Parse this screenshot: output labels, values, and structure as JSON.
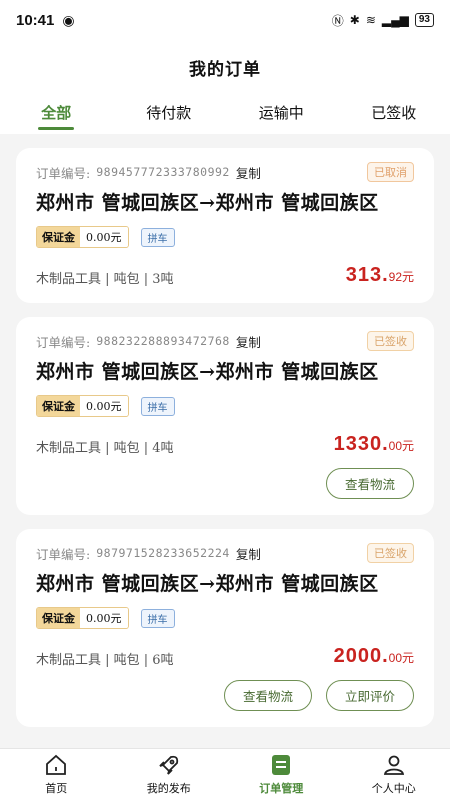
{
  "status_bar": {
    "time": "10:41",
    "battery": "93"
  },
  "header": {
    "title": "我的订单"
  },
  "tabs": [
    {
      "label": "全部",
      "active": true
    },
    {
      "label": "待付款",
      "active": false
    },
    {
      "label": "运输中",
      "active": false
    },
    {
      "label": "已签收",
      "active": false
    }
  ],
  "orders": [
    {
      "number_label": "订单编号:",
      "number": "989457772333780992",
      "copy_label": "复制",
      "status": "已取消",
      "route": "郑州市 管城回族区→郑州市 管城回族区",
      "deposit_label": "保证金",
      "deposit_value": "0.00元",
      "tag": "拼车",
      "goods": "木制品工具 | 吨包 | 3吨",
      "price_int": "313.",
      "price_dec": "92元",
      "buttons": []
    },
    {
      "number_label": "订单编号:",
      "number": "988232288893472768",
      "copy_label": "复制",
      "status": "已签收",
      "route": "郑州市 管城回族区→郑州市 管城回族区",
      "deposit_label": "保证金",
      "deposit_value": "0.00元",
      "tag": "拼车",
      "goods": "木制品工具 | 吨包 | 4吨",
      "price_int": "1330.",
      "price_dec": "00元",
      "buttons": [
        "查看物流"
      ]
    },
    {
      "number_label": "订单编号:",
      "number": "987971528233652224",
      "copy_label": "复制",
      "status": "已签收",
      "route": "郑州市 管城回族区→郑州市 管城回族区",
      "deposit_label": "保证金",
      "deposit_value": "0.00元",
      "tag": "拼车",
      "goods": "木制品工具 | 吨包 | 6吨",
      "price_int": "2000.",
      "price_dec": "00元",
      "buttons": [
        "查看物流",
        "立即评价"
      ]
    }
  ],
  "tabbar": [
    {
      "label": "首页",
      "icon": "home-icon",
      "active": false
    },
    {
      "label": "我的发布",
      "icon": "rocket-icon",
      "active": false
    },
    {
      "label": "订单管理",
      "icon": "order-list-icon",
      "active": true
    },
    {
      "label": "个人中心",
      "icon": "user-icon",
      "active": false
    }
  ],
  "colors": {
    "accent": "#4d8a3a",
    "price": "#c9231f"
  }
}
